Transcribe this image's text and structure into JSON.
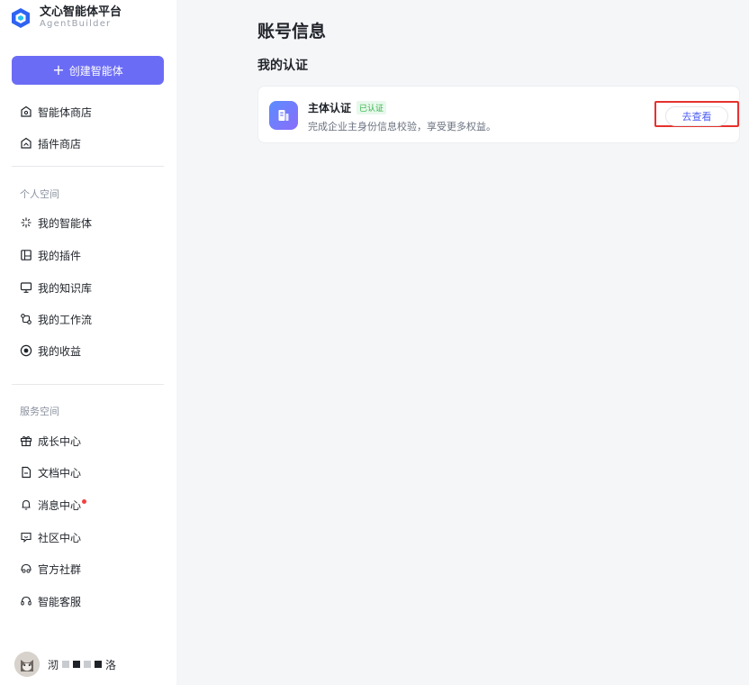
{
  "brand": {
    "title": "文心智能体平台",
    "subtitle": "AgentBuilder"
  },
  "sidebar": {
    "create_label": "创建智能体",
    "top_items": [
      {
        "label": "智能体商店",
        "icon": "store-icon"
      },
      {
        "label": "插件商店",
        "icon": "plugin-store-icon"
      }
    ],
    "personal_label": "个人空间",
    "personal_items": [
      {
        "label": "我的智能体",
        "icon": "sparkle-icon"
      },
      {
        "label": "我的插件",
        "icon": "plugin-icon"
      },
      {
        "label": "我的知识库",
        "icon": "monitor-icon"
      },
      {
        "label": "我的工作流",
        "icon": "workflow-icon"
      },
      {
        "label": "我的收益",
        "icon": "coin-icon"
      }
    ],
    "service_label": "服务空间",
    "service_items": [
      {
        "label": "成长中心",
        "icon": "gift-icon"
      },
      {
        "label": "文档中心",
        "icon": "document-icon"
      },
      {
        "label": "消息中心",
        "icon": "bell-icon",
        "has_unread": true
      },
      {
        "label": "社区中心",
        "icon": "chat-icon"
      },
      {
        "label": "官方社群",
        "icon": "headset-group-icon"
      },
      {
        "label": "智能客服",
        "icon": "headset-icon"
      }
    ],
    "user": {
      "name_start": "沏",
      "name_end": "洛"
    }
  },
  "main": {
    "page_title": "账号信息",
    "section_title": "我的认证",
    "card": {
      "title": "主体认证",
      "badge": "已认证",
      "description": "完成企业主身份信息校验，享受更多权益。",
      "action_label": "去查看"
    }
  },
  "colors": {
    "accent": "#6b6cf5",
    "link": "#4e5ef5",
    "success": "#2fb344",
    "highlight": "#e5322d",
    "unread_dot": "#f53f3f"
  }
}
